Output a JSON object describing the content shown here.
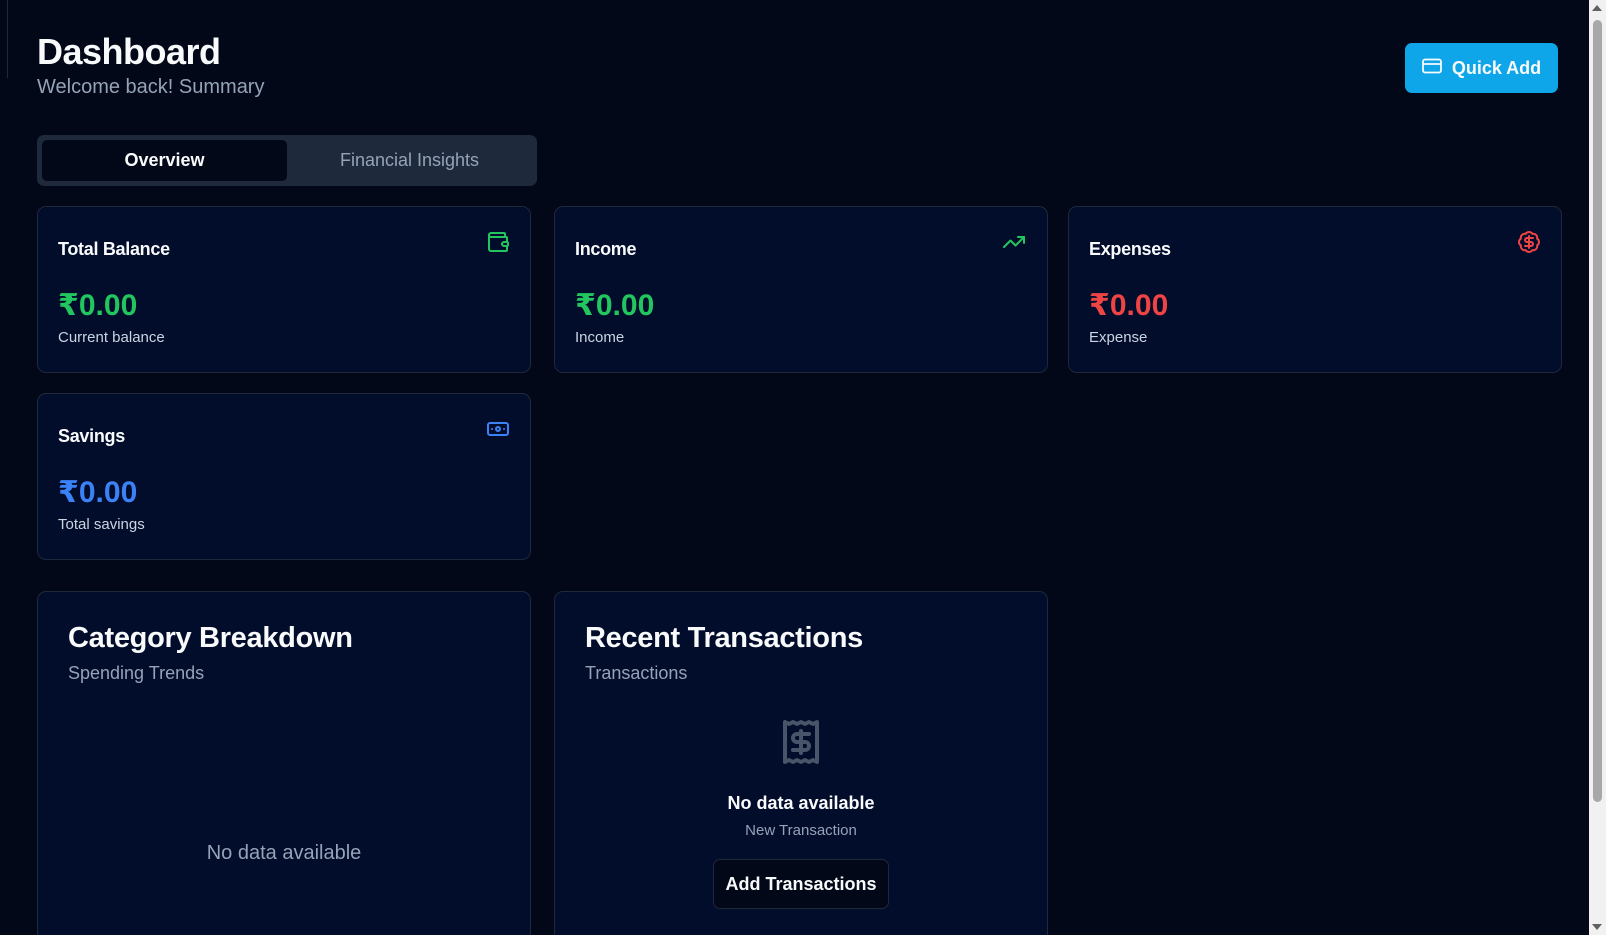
{
  "header": {
    "title": "Dashboard",
    "subtitle": "Welcome back! Summary",
    "quick_add_label": "Quick Add"
  },
  "tabs": [
    {
      "label": "Overview",
      "active": true
    },
    {
      "label": "Financial Insights",
      "active": false
    }
  ],
  "stats": {
    "balance": {
      "title": "Total Balance",
      "value": "₹0.00",
      "caption": "Current balance",
      "icon": "wallet-icon",
      "color": "#22c55e"
    },
    "income": {
      "title": "Income",
      "value": "₹0.00",
      "caption": "Income",
      "icon": "trending-up-icon",
      "color": "#22c55e"
    },
    "expenses": {
      "title": "Expenses",
      "value": "₹0.00",
      "caption": "Expense",
      "icon": "dollar-circle-icon",
      "color": "#ef4444"
    },
    "savings": {
      "title": "Savings",
      "value": "₹0.00",
      "caption": "Total savings",
      "icon": "banknote-icon",
      "color": "#3b82f6"
    }
  },
  "category": {
    "title": "Category Breakdown",
    "subtitle": "Spending Trends",
    "empty": "No data available"
  },
  "recent": {
    "title": "Recent Transactions",
    "subtitle": "Transactions",
    "empty_title": "No data available",
    "empty_sub": "New Transaction",
    "button_label": "Add Transactions",
    "icon": "receipt-icon"
  },
  "colors": {
    "background": "#020817",
    "card": "#020c2b",
    "accent": "#0ea5e9"
  }
}
